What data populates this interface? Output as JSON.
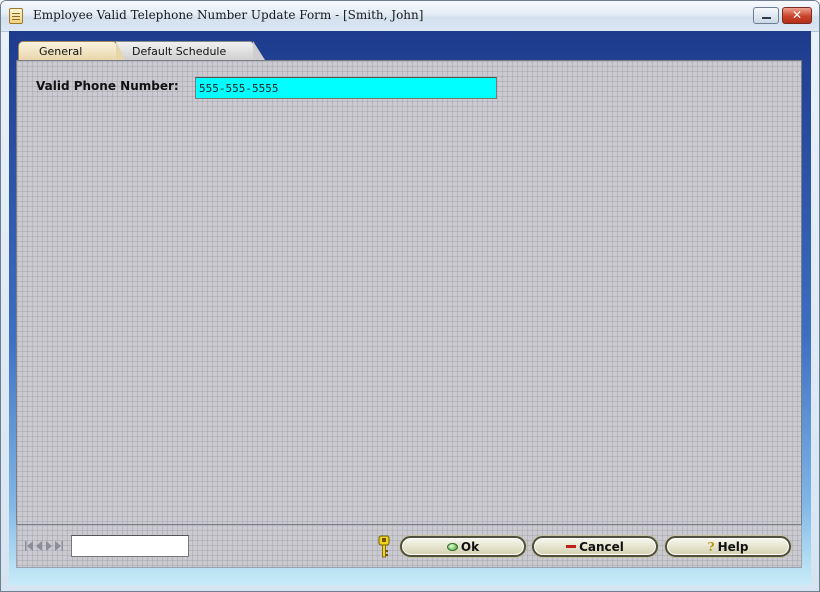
{
  "window": {
    "title": "Employee Valid Telephone Number Update Form - [Smith, John]",
    "minimize_icon": "minimize-icon",
    "close_glyph": "✕"
  },
  "tabs": [
    {
      "label": "General",
      "active": true
    },
    {
      "label": "Default Schedule",
      "active": false
    }
  ],
  "form": {
    "phone_label": "Valid Phone Number:",
    "phone_value": "555-555-5555",
    "phone_bg_color": "#00ffff"
  },
  "footer": {
    "nav_icons": [
      "first-record-icon",
      "previous-record-icon",
      "next-record-icon",
      "last-record-icon"
    ],
    "record_value": "",
    "ok_label": "Ok",
    "cancel_label": "Cancel",
    "help_label": "Help",
    "help_glyph": "?"
  },
  "colors": {
    "client_blue_top": "#1e3b8c",
    "panel_gray": "#cacad0",
    "active_tab": "#e8d6ab"
  }
}
